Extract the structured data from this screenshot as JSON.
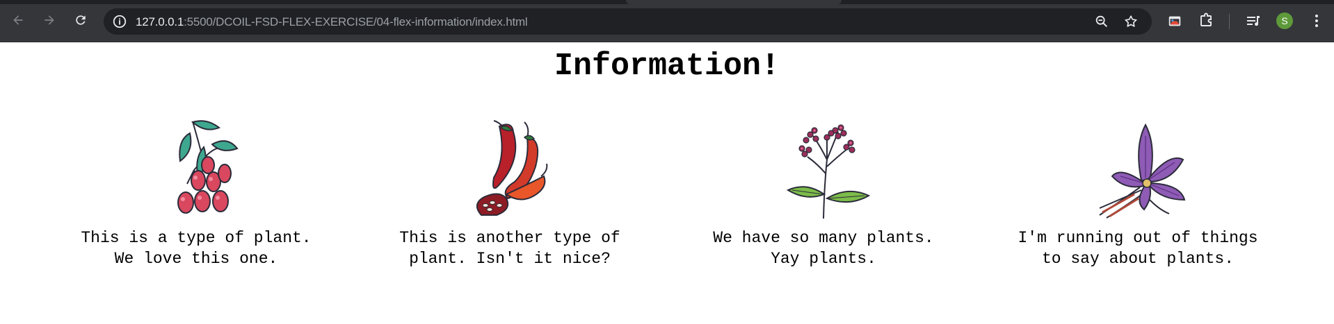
{
  "browser": {
    "url_host": "127.0.0.1",
    "url_rest": ":5500/DCOIL-FSD-FLEX-EXERCISE/04-flex-information/index.html",
    "profile_initial": "S",
    "icons": [
      "back-icon",
      "forward-icon",
      "reload-icon",
      "site-info-icon",
      "zoom-icon",
      "bookmark-star-icon",
      "extension-app-icon",
      "puzzle-icon",
      "media-queue-icon",
      "kebab-menu-icon"
    ]
  },
  "page": {
    "title": "Information!",
    "cards": [
      {
        "line1": "This is a type of plant.",
        "line2": "We love this one.",
        "image": "berries"
      },
      {
        "line1": "This is another type of",
        "line2": "plant. Isn't it nice?",
        "image": "chili-peppers"
      },
      {
        "line1": "We have so many plants.",
        "line2": "Yay plants.",
        "image": "flowering-sprig"
      },
      {
        "line1": "I'm running out of things",
        "line2": "to say about plants.",
        "image": "purple-flower"
      }
    ]
  },
  "colors": {
    "chrome": "#35363a",
    "omnibox": "#202124",
    "avatar": "#5e9a3a"
  }
}
